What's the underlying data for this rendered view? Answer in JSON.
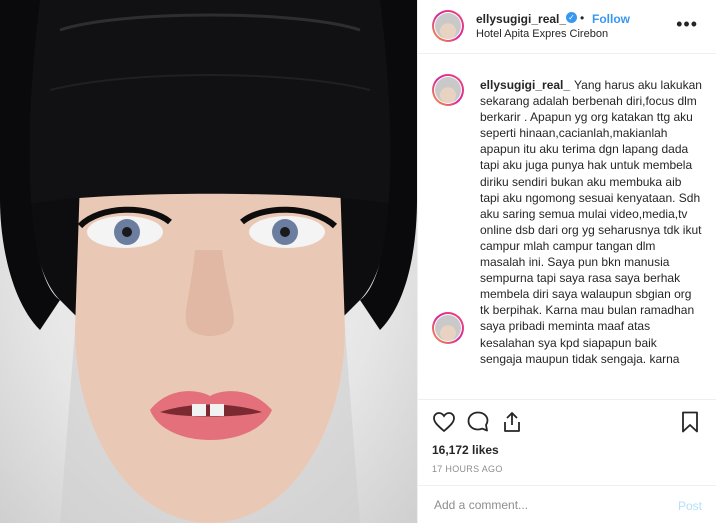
{
  "header": {
    "username": "ellysugigi_real_",
    "follow_label": "Follow",
    "separator": "•",
    "location": "Hotel Apita Expres Cirebon",
    "more_label": "•••"
  },
  "caption": {
    "username": "ellysugigi_real_",
    "text": "Yang harus aku lakukan sekarang adalah berbenah diri,focus dlm berkarir . Apapun yg org katakan ttg aku seperti hinaan,cacianlah,makianlah apapun itu aku terima dgn lapang dada tapi aku juga punya hak untuk membela diriku sendiri bukan aku membuka aib tapi aku ngomong sesuai kenyataan. Sdh aku saring semua mulai video,media,tv online dsb dari org yg seharusnya tdk ikut campur mlah campur tangan dlm masalah ini. Saya pun bkn manusia sempurna tapi saya rasa saya berhak membela diri saya walaupun sbgian org tk berpihak. Karna mau bulan ramadhan saya pribadi meminta maaf atas kesalahan sya kpd siapapun baik sengaja maupun tidak sengaja. karna"
  },
  "actions": {
    "likes": "16,172 likes",
    "timestamp": "17 HOURS AGO"
  },
  "comment_box": {
    "placeholder": "Add a comment...",
    "post_label": "Post"
  },
  "icons": {
    "like": "heart-icon",
    "comment": "comment-icon",
    "share": "share-icon",
    "save": "bookmark-icon",
    "verified": "verified-badge-icon"
  },
  "colors": {
    "link": "#3897f0",
    "text": "#262626",
    "muted": "#8e8e8e",
    "post_disabled": "#b2dffc",
    "border": "#efefef"
  }
}
